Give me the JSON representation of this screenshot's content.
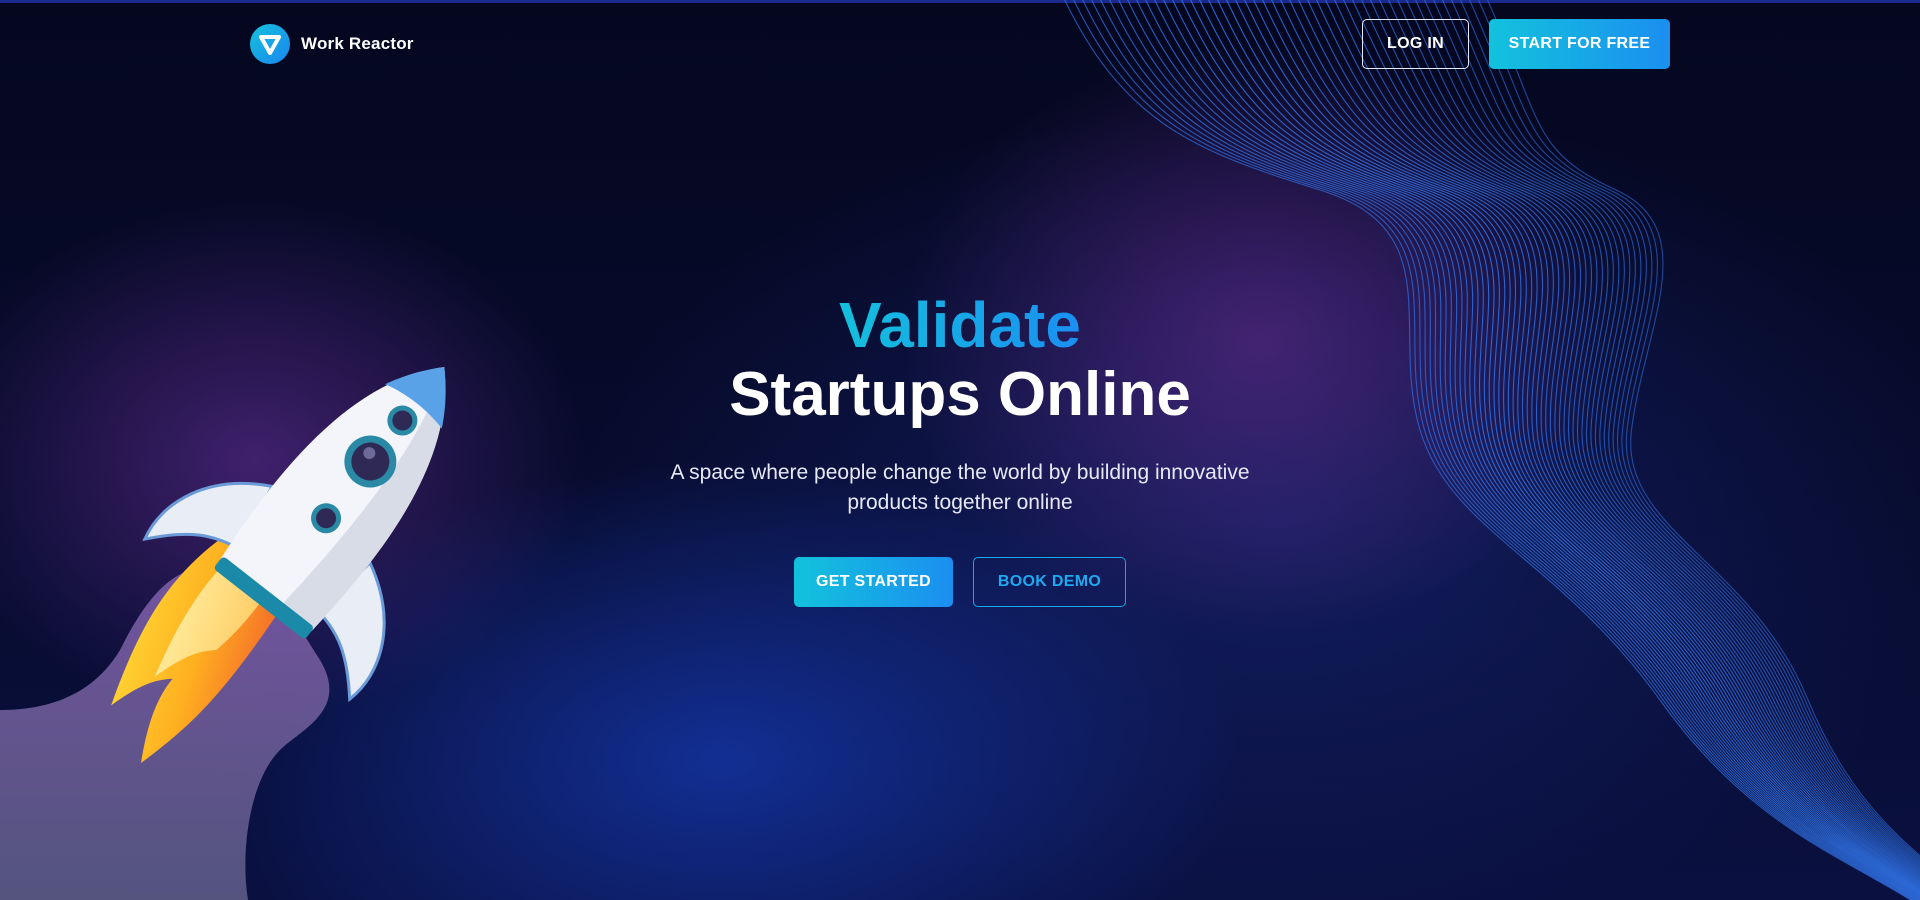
{
  "header": {
    "brand_name": "Work Reactor",
    "login_label": "LOG IN",
    "start_free_label": "START FOR FREE"
  },
  "hero": {
    "title_line_1": "Validate",
    "title_line_2": "Startups Online",
    "subtitle": "A space where people change the world by building innovative products together online",
    "primary_cta": "GET STARTED",
    "secondary_cta": "BOOK DEMO"
  },
  "illustrations": {
    "left": "rocket-icon",
    "right": "line-wave-pattern",
    "logo": "shield-logo-icon"
  },
  "colors": {
    "background": "#060a2a",
    "accent_start": "#12c2dc",
    "accent_end": "#1b8ff0",
    "text_primary": "#ffffff",
    "wave_lines": "#2f6fe0"
  }
}
